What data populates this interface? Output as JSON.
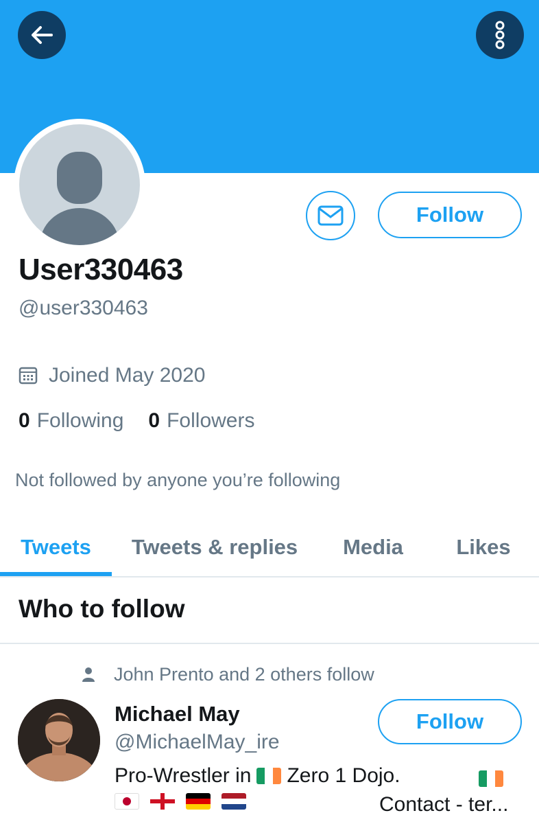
{
  "profile": {
    "display_name": "User330463",
    "handle": "@user330463",
    "joined": "Joined May 2020",
    "following_count": "0",
    "following_label": "Following",
    "followers_count": "0",
    "followers_label": "Followers",
    "not_followed_text": "Not followed by anyone you’re following",
    "follow_label": "Follow"
  },
  "tabs": [
    {
      "label": "Tweets",
      "active": true
    },
    {
      "label": "Tweets & replies",
      "active": false
    },
    {
      "label": "Media",
      "active": false
    },
    {
      "label": "Likes",
      "active": false
    }
  ],
  "who_to_follow": {
    "title": "Who to follow",
    "suggestion": {
      "social_context": "John Prento and 2 others follow",
      "name": "Michael May",
      "handle": "@MichaelMay_ire",
      "bio_line1_a": "Pro-Wrestler in",
      "bio_line1_b": "Zero 1 Dojo.",
      "bio_line2_right": "Contact - ter...",
      "follow_label": "Follow"
    }
  },
  "colors": {
    "accent": "#1da1f2",
    "banner": "#1da1f2",
    "header_button_bg": "#0f3d63",
    "secondary_text": "#657786"
  },
  "icons": {
    "back": "arrow-left-icon",
    "more": "more-vertical-icon",
    "message": "envelope-icon",
    "joined": "calendar-icon",
    "social": "person-icon"
  }
}
